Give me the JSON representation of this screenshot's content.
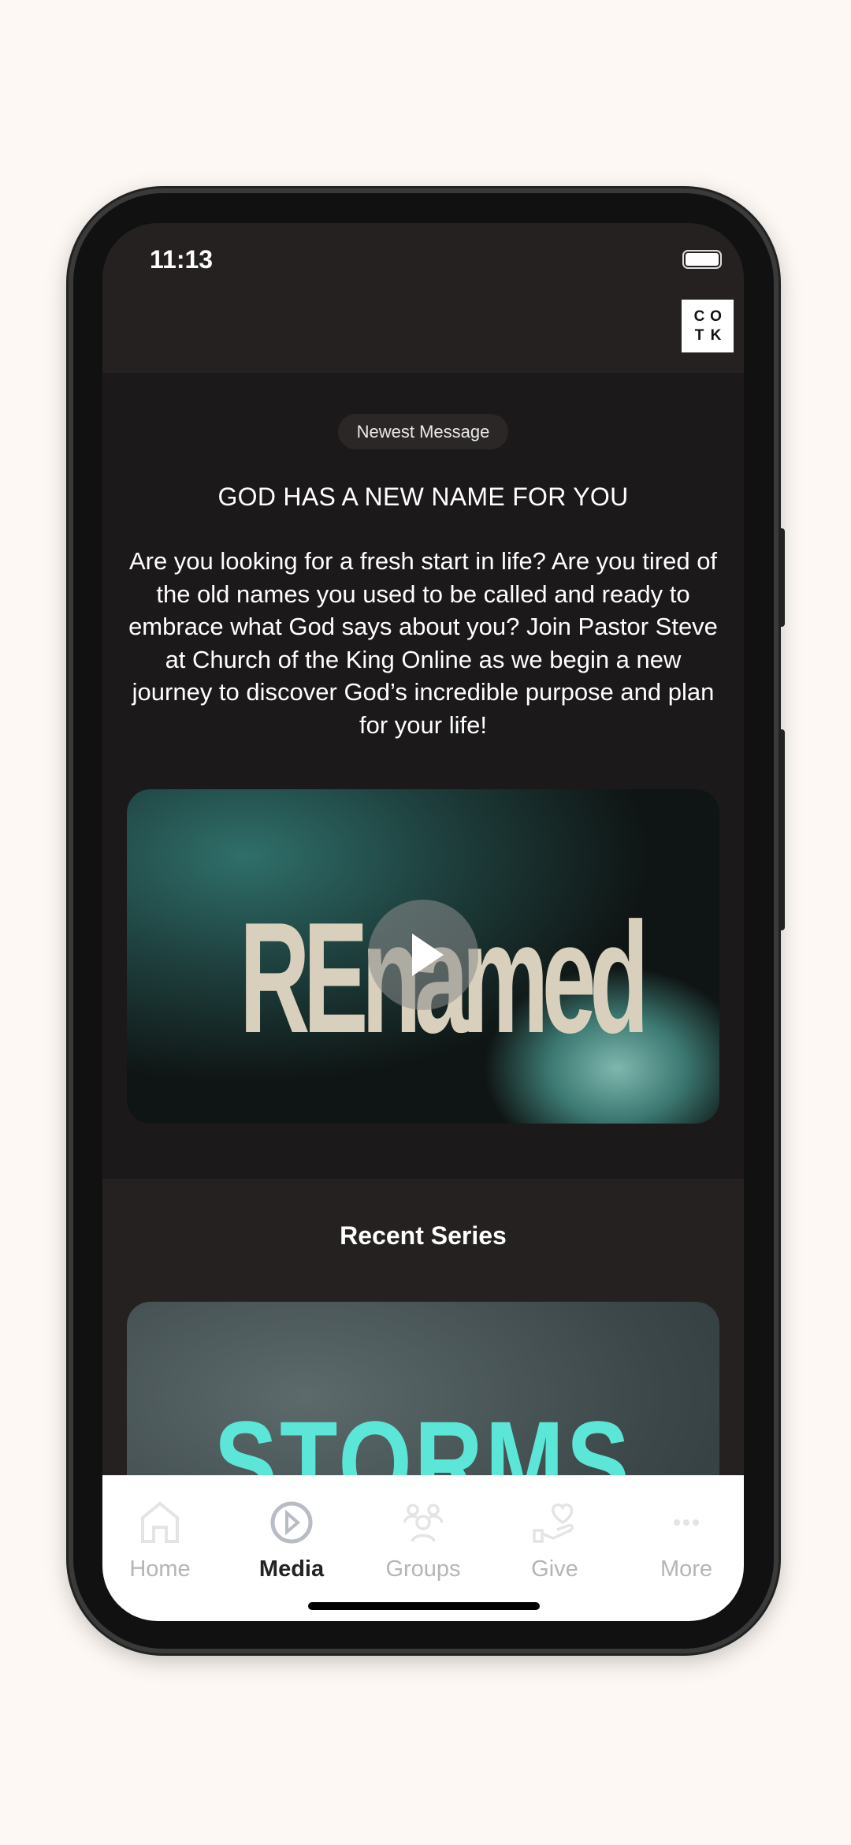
{
  "status_bar": {
    "time": "11:13"
  },
  "header": {
    "logo_letters": [
      "C",
      "O",
      "T",
      "K"
    ]
  },
  "newest": {
    "badge": "Newest Message",
    "title": "GOD HAS A NEW NAME FOR YOU",
    "description": "Are you looking for a fresh start in life? Are you tired of the old names you used to be called and ready to embrace what God says about you? Join Pastor Steve at Church of the King Online as we begin a new journey to discover God’s incredible purpose and plan for your life!",
    "video_title_art": "REnamed"
  },
  "recent": {
    "heading": "Recent Series",
    "series_art": "STORMS"
  },
  "tabs": [
    {
      "label": "Home",
      "icon": "home-icon"
    },
    {
      "label": "Media",
      "icon": "play-circle-icon",
      "active": true
    },
    {
      "label": "Groups",
      "icon": "groups-icon"
    },
    {
      "label": "Give",
      "icon": "give-hand-heart-icon"
    },
    {
      "label": "More",
      "icon": "more-dots-icon"
    }
  ],
  "colors": {
    "header": "#262121",
    "main": "#1b1919",
    "accent_series": "#5ce6d8",
    "tab_inactive": "#b5b5b5",
    "tab_active": "#222222"
  }
}
